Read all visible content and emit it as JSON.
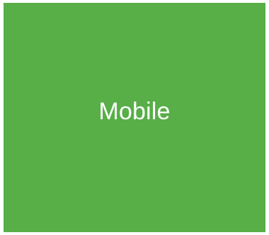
{
  "tile": {
    "label": "Mobile",
    "background_color": "#58AE47",
    "text_color": "#FFFFFF"
  }
}
